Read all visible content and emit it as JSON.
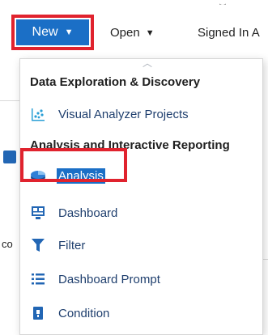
{
  "toolbar": {
    "new_label": "New",
    "open_label": "Open",
    "signed_in_label": "Signed In A"
  },
  "menu": {
    "sections": [
      {
        "heading": "Data Exploration & Discovery",
        "items": [
          {
            "label": "Visual Analyzer Projects",
            "icon": "visual-analyzer-icon"
          }
        ]
      },
      {
        "heading": "Analysis and Interactive Reporting",
        "items": [
          {
            "label": "Analysis",
            "icon": "analysis-pie-icon",
            "selected": true
          },
          {
            "label": "Dashboard",
            "icon": "dashboard-icon"
          },
          {
            "label": "Filter",
            "icon": "filter-icon"
          },
          {
            "label": "Dashboard Prompt",
            "icon": "dashboard-prompt-icon"
          },
          {
            "label": "Condition",
            "icon": "condition-icon"
          }
        ]
      }
    ]
  },
  "background": {
    "partial_text": "co"
  },
  "colors": {
    "accent": "#1b6fc6",
    "highlight": "#e0232e",
    "icon_blue": "#2266b4"
  }
}
